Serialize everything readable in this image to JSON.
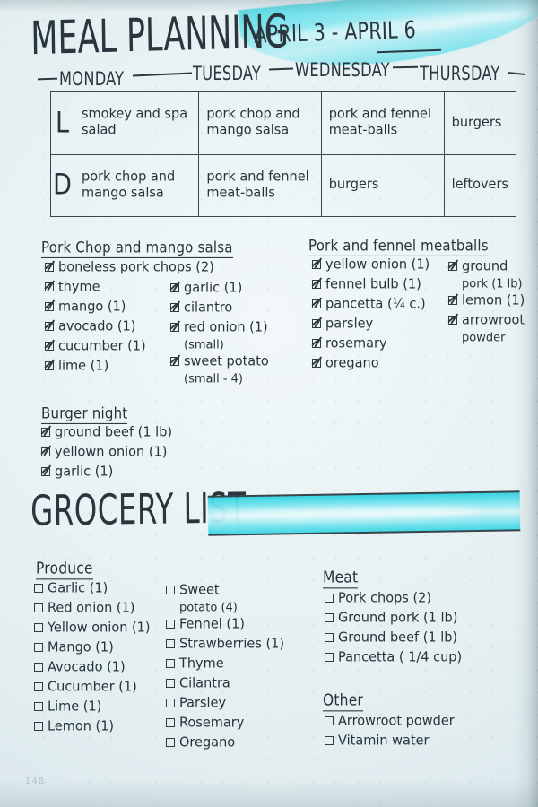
{
  "page": {
    "number": "148",
    "paper": "dot-grid",
    "accent_color": "#2fd2e2",
    "ink_color": "#27333b"
  },
  "header": {
    "title": "MEAL PLANNING",
    "date_range": "APRIL 3 - APRIL 6",
    "days": [
      "MONDAY",
      "TUESDAY",
      "WEDNESDAY",
      "THURSDAY"
    ]
  },
  "meal_table": {
    "row_labels": [
      "L",
      "D"
    ],
    "rows": [
      {
        "label": "L",
        "cells": [
          "smokey and spa salad",
          "pork chop and mango salsa",
          "pork and fennel meat-balls",
          "burgers"
        ]
      },
      {
        "label": "D",
        "cells": [
          "pork chop and mango salsa",
          "pork and fennel meat-balls",
          "burgers",
          "leftovers"
        ]
      }
    ]
  },
  "recipes": [
    {
      "title": "Pork Chop and mango salsa",
      "col_left": [
        {
          "label": "boneless pork chops (2)",
          "checked": true
        },
        {
          "label": "thyme",
          "checked": true
        },
        {
          "label": "mango (1)",
          "checked": true
        },
        {
          "label": "avocado (1)",
          "checked": true
        },
        {
          "label": "cucumber (1)",
          "checked": true
        },
        {
          "label": "lime (1)",
          "checked": true
        }
      ],
      "col_right": [
        {
          "label": "garlic (1)",
          "checked": true
        },
        {
          "label": "cilantro",
          "checked": true
        },
        {
          "label": "red onion (1)",
          "sub": "(small)",
          "checked": true
        },
        {
          "label": "sweet potato",
          "sub": "(small - 4)",
          "checked": true
        }
      ]
    },
    {
      "title": "Pork and fennel meatballs",
      "col_left": [
        {
          "label": "yellow onion (1)",
          "checked": true
        },
        {
          "label": "fennel bulb (1)",
          "checked": true
        },
        {
          "label": "pancetta (¼ c.)",
          "checked": true
        },
        {
          "label": "parsley",
          "checked": true
        },
        {
          "label": "rosemary",
          "checked": true
        },
        {
          "label": "oregano",
          "checked": true
        }
      ],
      "col_right": [
        {
          "label": "ground",
          "sub": "pork (1 lb)",
          "checked": true
        },
        {
          "label": "lemon (1)",
          "checked": true
        },
        {
          "label": "arrowroot",
          "sub": "powder",
          "checked": true
        }
      ]
    },
    {
      "title": "Burger night",
      "col_left": [
        {
          "label": "ground beef (1 lb)",
          "checked": true
        },
        {
          "label": "yellown onion (1)",
          "checked": true
        },
        {
          "label": "garlic (1)",
          "checked": true
        }
      ],
      "col_right": []
    }
  ],
  "grocery": {
    "title": "GROCERY LIST",
    "sections": [
      {
        "name": "Produce",
        "items": [
          {
            "label": "Garlic (1)",
            "checked": false
          },
          {
            "label": "Red onion (1)",
            "checked": false
          },
          {
            "label": "Yellow onion (1)",
            "checked": false
          },
          {
            "label": "Mango (1)",
            "checked": false
          },
          {
            "label": "Avocado (1)",
            "checked": false
          },
          {
            "label": "Cucumber (1)",
            "checked": false
          },
          {
            "label": "Lime (1)",
            "checked": false
          },
          {
            "label": "Lemon (1)",
            "checked": false
          }
        ]
      },
      {
        "name": "",
        "items": [
          {
            "label": "Sweet",
            "sub": "potato (4)",
            "checked": false
          },
          {
            "label": "Fennel (1)",
            "checked": false
          },
          {
            "label": "Strawberries (1)",
            "checked": false
          },
          {
            "label": "Thyme",
            "checked": false
          },
          {
            "label": "Cilantra",
            "checked": false
          },
          {
            "label": "Parsley",
            "checked": false
          },
          {
            "label": "Rosemary",
            "checked": false
          },
          {
            "label": "Oregano",
            "checked": false
          }
        ]
      },
      {
        "name": "Meat",
        "items": [
          {
            "label": "Pork chops (2)",
            "checked": false
          },
          {
            "label": "Ground pork (1 lb)",
            "checked": false
          },
          {
            "label": "Ground beef (1 lb)",
            "checked": false
          },
          {
            "label": "Pancetta ( 1/4 cup)",
            "checked": false
          }
        ]
      },
      {
        "name": "Other",
        "items": [
          {
            "label": "Arrowroot powder",
            "checked": false
          },
          {
            "label": "Vitamin water",
            "checked": false
          }
        ]
      }
    ]
  }
}
